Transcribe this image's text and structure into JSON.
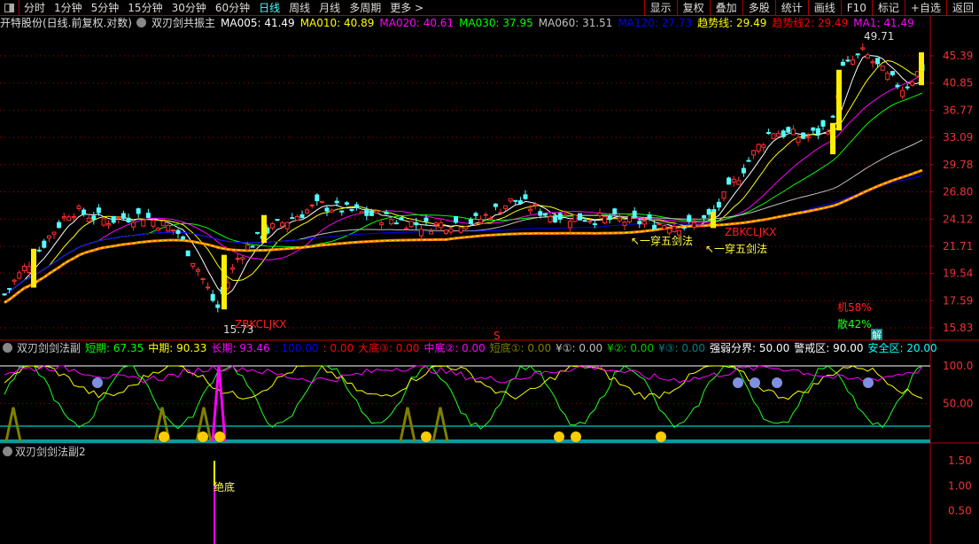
{
  "toolbar": {
    "periods": [
      "分时",
      "1分钟",
      "5分钟",
      "15分钟",
      "30分钟",
      "60分钟",
      "日线",
      "周线",
      "月线",
      "多周期",
      "更多 >"
    ],
    "active": "日线",
    "right_buttons": [
      "显示",
      "复权",
      "叠加",
      "多股",
      "统计",
      "画线",
      "F10",
      "标记",
      "+自选",
      "返回"
    ]
  },
  "main": {
    "title": "开特股份(日线.前复权.对数)",
    "indicator": "双刃剑共振主",
    "ma": [
      {
        "label": "MA005: 41.49",
        "color": "#ffffff"
      },
      {
        "label": "MA010: 40.89",
        "color": "#ffff00"
      },
      {
        "label": "MA020: 40.61",
        "color": "#ff00ff"
      },
      {
        "label": "MA030: 37.95",
        "color": "#00ff00"
      },
      {
        "label": "MA060: 31.51",
        "color": "#c0c0c0"
      },
      {
        "label": "MA120: 27.73",
        "color": "#0000ff"
      },
      {
        "label": "趋势线: 29.49",
        "color": "#ffff00"
      },
      {
        "label": "趋势线2: 29.49",
        "color": "#ff0000"
      },
      {
        "label": "MA1: 41.49",
        "color": "#ff00ff"
      }
    ],
    "y_ticks": [
      "45.39",
      "40.85",
      "36.77",
      "33.09",
      "29.78",
      "26.80",
      "24.12",
      "21.71",
      "19.54",
      "17.59",
      "15.83"
    ],
    "annotations": {
      "high": "49.71",
      "low": "15.73",
      "zbk1": "ZBKCLJKX",
      "zbk2": "ZBKCLJKX",
      "sword1": "↖一穿五剑法",
      "sword2": "↖一穿五剑法",
      "inst": "机58%",
      "retail": "散42%",
      "jie": "解",
      "s": "S"
    }
  },
  "sub1": {
    "indicator": "双刃剑剑法副",
    "items": [
      {
        "label": "短期: 67.35",
        "color": "#00ff00"
      },
      {
        "label": "中期: 90.33",
        "color": "#ffff00"
      },
      {
        "label": "长期: 93.46",
        "color": "#ff00ff"
      },
      {
        "label": ": 100.00",
        "color": "#0000ff"
      },
      {
        "label": ": 0.00",
        "color": "#ff0000"
      },
      {
        "label": "大底③: 0.00",
        "color": "#ff0000"
      },
      {
        "label": "中底②: 0.00",
        "color": "#ff00ff"
      },
      {
        "label": "短底①: 0.00",
        "color": "#808000"
      },
      {
        "label": "¥①: 0.00",
        "color": "#c0c0c0"
      },
      {
        "label": "¥②: 0.00",
        "color": "#00cc00"
      },
      {
        "label": "¥③: 0.00",
        "color": "#008080"
      },
      {
        "label": "强弱分界: 50.00",
        "color": "#ffffff"
      },
      {
        "label": "警戒区: 90.00",
        "color": "#ffffff"
      },
      {
        "label": "安全区: 20.00",
        "color": "#00ffff"
      }
    ],
    "y_ticks": [
      "100.0",
      "50.00"
    ]
  },
  "sub2": {
    "indicator": "双刃剑剑法副2",
    "y_ticks": [
      "1.50",
      "1.00",
      "0.50"
    ],
    "signal": "绝底"
  }
}
